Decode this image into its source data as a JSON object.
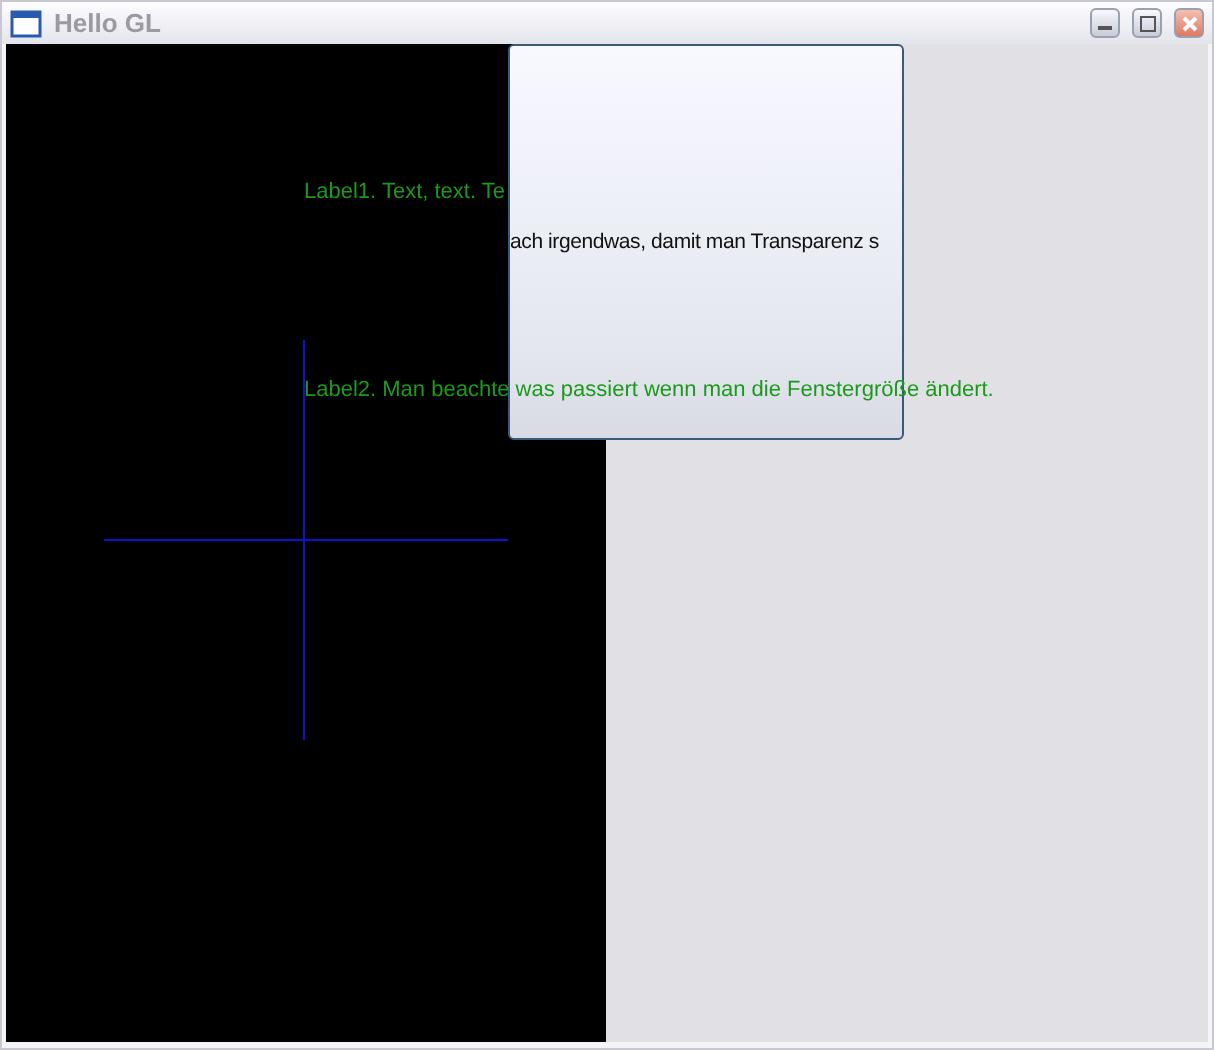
{
  "window": {
    "title": "Hello GL"
  },
  "canvas": {
    "label1": "Label1. Text, text. Te",
    "label2": "Label2. Man beachte was passiert wenn man die Fenstergröße ändert."
  },
  "overlay_panel": {
    "text": "ach irgendwas, damit man Transparenz s"
  }
}
